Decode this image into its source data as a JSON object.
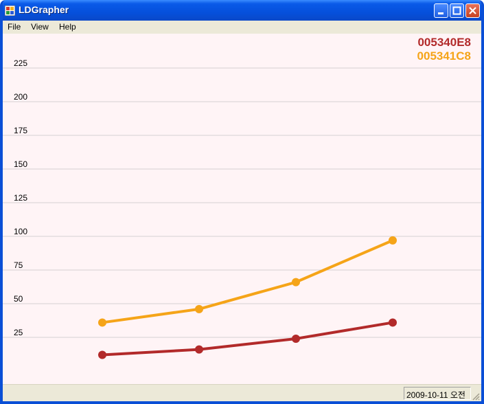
{
  "window": {
    "title": "LDGrapher"
  },
  "menu": {
    "items": [
      "File",
      "View",
      "Help"
    ]
  },
  "chart_data": {
    "type": "line",
    "x": [
      1,
      2,
      3,
      4
    ],
    "ylim": [
      0,
      240
    ],
    "yticks": [
      25,
      50,
      75,
      100,
      125,
      150,
      175,
      200,
      225
    ],
    "grid": true,
    "legend_position": "top-right",
    "series": [
      {
        "name": "005340E8",
        "color": "#b22a2a",
        "values": [
          12,
          16,
          24,
          36
        ]
      },
      {
        "name": "005341C8",
        "color": "#f5a418",
        "values": [
          36,
          46,
          66,
          97
        ]
      }
    ]
  },
  "status": {
    "datetime": "2009-10-11 오전"
  }
}
